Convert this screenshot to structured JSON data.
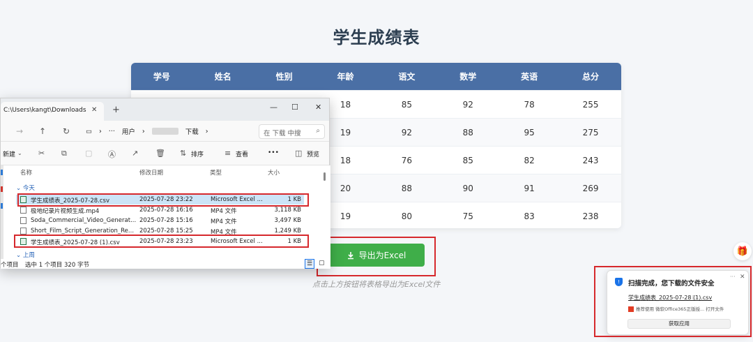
{
  "page": {
    "title": "学生成绩表",
    "export_button": "导出为Excel",
    "export_hint": "点击上方按钮将表格导出为Excel文件"
  },
  "table": {
    "headers": [
      "学号",
      "姓名",
      "性别",
      "年龄",
      "语文",
      "数学",
      "英语",
      "总分"
    ],
    "rows": [
      [
        "",
        "",
        "",
        "18",
        "85",
        "92",
        "78",
        "255"
      ],
      [
        "",
        "",
        "",
        "19",
        "92",
        "88",
        "95",
        "275"
      ],
      [
        "",
        "",
        "",
        "18",
        "76",
        "85",
        "82",
        "243"
      ],
      [
        "",
        "",
        "",
        "20",
        "88",
        "90",
        "91",
        "269"
      ],
      [
        "",
        "",
        "",
        "19",
        "80",
        "75",
        "83",
        "238"
      ]
    ]
  },
  "explorer": {
    "tab_title": "C:\\Users\\kangt\\Downloads",
    "address": {
      "user": "用户",
      "folder": "下载"
    },
    "search_placeholder": "在 下载 中搜",
    "toolbar": {
      "new": "新建",
      "sort": "排序",
      "view": "查看",
      "more": "•••",
      "preview": "预览"
    },
    "columns": {
      "name": "名称",
      "date": "修改日期",
      "type": "类型",
      "size": "大小"
    },
    "groups": {
      "today": "今天",
      "last_week": "上周"
    },
    "files": [
      {
        "name": "学生成绩表_2025-07-28.csv",
        "date": "2025-07-28 23:22",
        "type": "Microsoft Excel ...",
        "size": "1 KB",
        "icon": "excel-file-icon"
      },
      {
        "name": "极地纪录片视频生成.mp4",
        "date": "2025-07-28 16:16",
        "type": "MP4 文件",
        "size": "3,118 KB",
        "icon": "file-icon"
      },
      {
        "name": "Soda_Commercial_Video_Generat...",
        "date": "2025-07-28 15:16",
        "type": "MP4 文件",
        "size": "3,497 KB",
        "icon": "file-icon"
      },
      {
        "name": "Short_Film_Script_Generation_Re...",
        "date": "2025-07-28 15:25",
        "type": "MP4 文件",
        "size": "1,249 KB",
        "icon": "file-icon"
      },
      {
        "name": "学生成绩表_2025-07-28 (1).csv",
        "date": "2025-07-28 23:23",
        "type": "Microsoft Excel ...",
        "size": "1 KB",
        "icon": "excel-file-icon"
      }
    ],
    "status": {
      "count": "个项目",
      "selection": "选中 1 个项目  320 字节"
    }
  },
  "notification": {
    "title": "扫描完成，您下载的文件安全",
    "file": "学生成绩表_2025-07-28 (1).csv",
    "recommend": "推荐使用 微软Office365正版授... 打开文件",
    "button": "获取应用",
    "menu": "···",
    "close": "✕"
  },
  "colors": {
    "table_header": "#4a6fa5",
    "export_button": "#3fae49",
    "highlight_box": "#d6282c",
    "selected_row": "#cce4f7"
  }
}
